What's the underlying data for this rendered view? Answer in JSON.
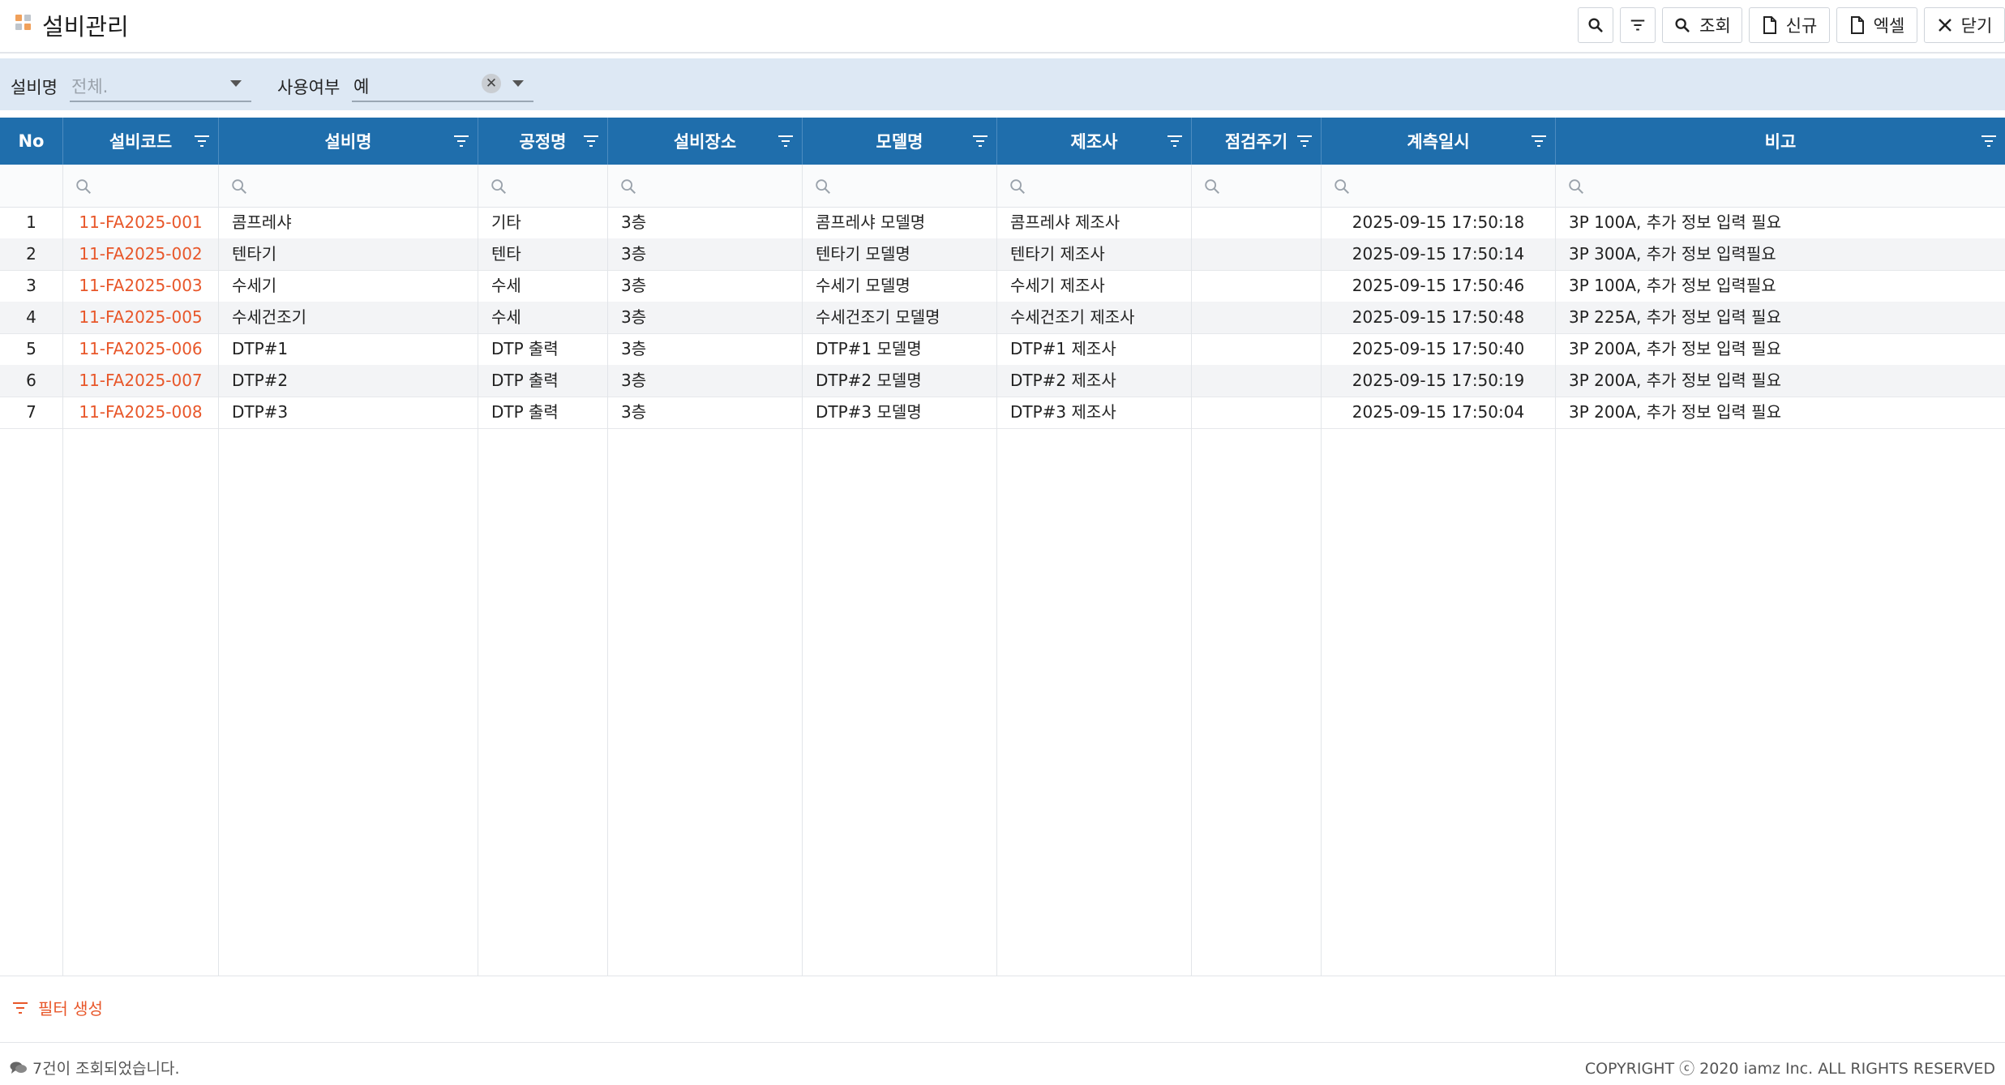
{
  "app": {
    "title": "설비관리"
  },
  "toolbar": {
    "search_label": "조회",
    "new_label": "신규",
    "excel_label": "엑셀",
    "close_label": "닫기"
  },
  "filters": {
    "equip_name_label": "설비명",
    "equip_name_placeholder": "전체.",
    "use_label": "사용여부",
    "use_value": "예"
  },
  "table": {
    "columns": [
      "No",
      "설비코드",
      "설비명",
      "공정명",
      "설비장소",
      "모델명",
      "제조사",
      "점검주기",
      "계측일시",
      "비고"
    ],
    "rows": [
      {
        "no": "1",
        "code": "11-FA2025-001",
        "name": "콤프레샤",
        "process": "기타",
        "location": "3층",
        "model": "콤프레샤 모델명",
        "maker": "콤프레샤 제조사",
        "cycle": "",
        "measured": "2025-09-15 17:50:18",
        "note": "3P 100A, 추가 정보 입력 필요"
      },
      {
        "no": "2",
        "code": "11-FA2025-002",
        "name": "텐타기",
        "process": "텐타",
        "location": "3층",
        "model": "텐타기 모델명",
        "maker": "텐타기 제조사",
        "cycle": "",
        "measured": "2025-09-15 17:50:14",
        "note": "3P 300A, 추가 정보 입력필요"
      },
      {
        "no": "3",
        "code": "11-FA2025-003",
        "name": "수세기",
        "process": "수세",
        "location": "3층",
        "model": "수세기 모델명",
        "maker": "수세기 제조사",
        "cycle": "",
        "measured": "2025-09-15 17:50:46",
        "note": "3P 100A, 추가 정보 입력필요"
      },
      {
        "no": "4",
        "code": "11-FA2025-005",
        "name": "수세건조기",
        "process": "수세",
        "location": "3층",
        "model": "수세건조기 모델명",
        "maker": "수세건조기 제조사",
        "cycle": "",
        "measured": "2025-09-15 17:50:48",
        "note": "3P 225A, 추가 정보 입력 필요"
      },
      {
        "no": "5",
        "code": "11-FA2025-006",
        "name": "DTP#1",
        "process": "DTP 출력",
        "location": "3층",
        "model": "DTP#1 모델명",
        "maker": "DTP#1 제조사",
        "cycle": "",
        "measured": "2025-09-15 17:50:40",
        "note": "3P 200A, 추가 정보 입력 필요"
      },
      {
        "no": "6",
        "code": "11-FA2025-007",
        "name": "DTP#2",
        "process": "DTP 출력",
        "location": "3층",
        "model": "DTP#2 모델명",
        "maker": "DTP#2 제조사",
        "cycle": "",
        "measured": "2025-09-15 17:50:19",
        "note": "3P 200A, 추가 정보 입력 필요"
      },
      {
        "no": "7",
        "code": "11-FA2025-008",
        "name": "DTP#3",
        "process": "DTP 출력",
        "location": "3층",
        "model": "DTP#3 모델명",
        "maker": "DTP#3 제조사",
        "cycle": "",
        "measured": "2025-09-15 17:50:04",
        "note": "3P 200A, 추가 정보 입력 필요"
      }
    ]
  },
  "footer": {
    "filter_create_label": "필터 생성",
    "status_text": "7건이 조회되었습니다.",
    "copyright": "COPYRIGHT ⓒ 2020 iamz Inc. ALL RIGHTS RESERVED"
  },
  "colors": {
    "header_bg": "#1f6eac",
    "filter_bar_bg": "#dde8f4",
    "accent_orange": "#e8572a"
  },
  "icons": {
    "app": "grid-dots-icon",
    "search": "search-icon",
    "filter": "filter-icon",
    "document": "document-icon",
    "close": "close-icon",
    "chat": "chat-bubble-icon"
  }
}
